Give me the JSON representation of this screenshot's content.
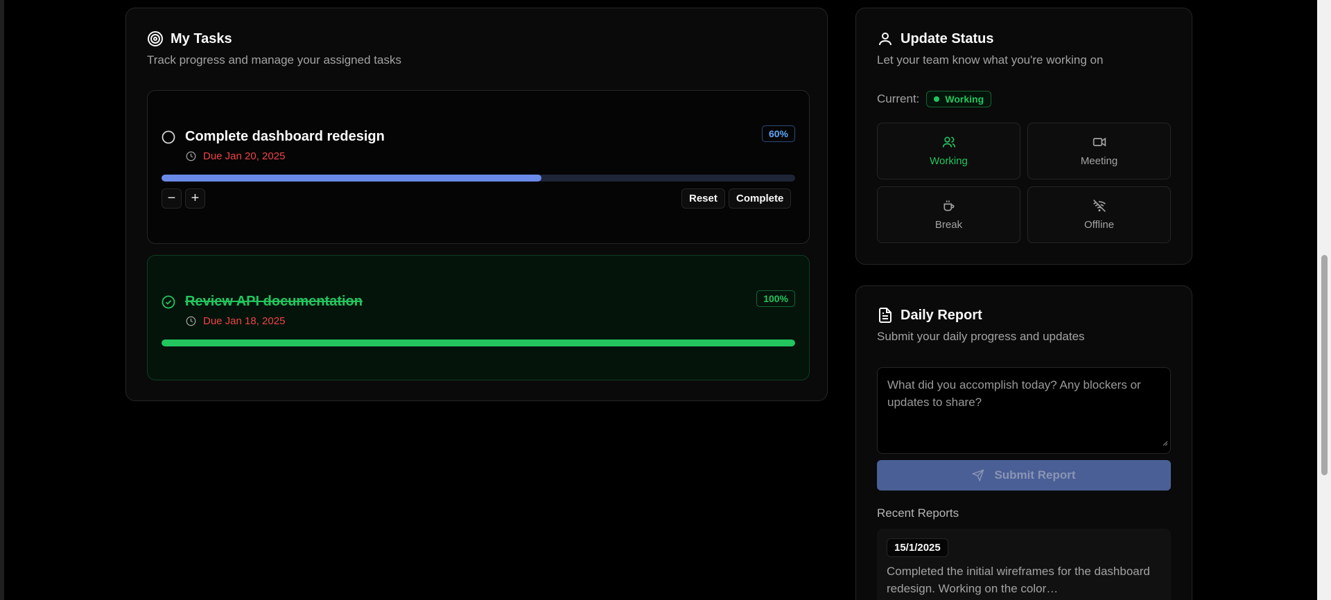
{
  "tasks_card": {
    "title": "My Tasks",
    "subtitle": "Track progress and manage your assigned tasks",
    "tasks": [
      {
        "name": "Complete dashboard redesign",
        "due": "Due Jan 20, 2025",
        "progress_label": "60%",
        "progress": 60,
        "completed": false,
        "reset_label": "Reset",
        "complete_label": "Complete",
        "decrease_symbol": "−",
        "increase_symbol": "+"
      },
      {
        "name": "Review API documentation",
        "due": "Due Jan 18, 2025",
        "progress_label": "100%",
        "progress": 100,
        "completed": true
      }
    ]
  },
  "status_card": {
    "title": "Update Status",
    "subtitle": "Let your team know what you're working on",
    "current_label": "Current:",
    "current_value": "Working",
    "options": [
      {
        "label": "Working",
        "icon": "users-icon",
        "active": true
      },
      {
        "label": "Meeting",
        "icon": "video-icon",
        "active": false
      },
      {
        "label": "Break",
        "icon": "coffee-icon",
        "active": false
      },
      {
        "label": "Offline",
        "icon": "wifi-off-icon",
        "active": false
      }
    ]
  },
  "report_card": {
    "title": "Daily Report",
    "subtitle": "Submit your daily progress and updates",
    "textarea_placeholder": "What did you accomplish today? Any blockers or updates to share?",
    "submit_label": "Submit Report",
    "recent_title": "Recent Reports",
    "recent": [
      {
        "date": "15/1/2025",
        "text": "Completed the initial wireframes for the dashboard redesign. Working on the color…"
      }
    ]
  },
  "colors": {
    "accent_green": "#22c55e",
    "accent_blue": "#6a8ae8",
    "danger_red": "#ef4444",
    "submit_bg": "#4a5f96"
  }
}
